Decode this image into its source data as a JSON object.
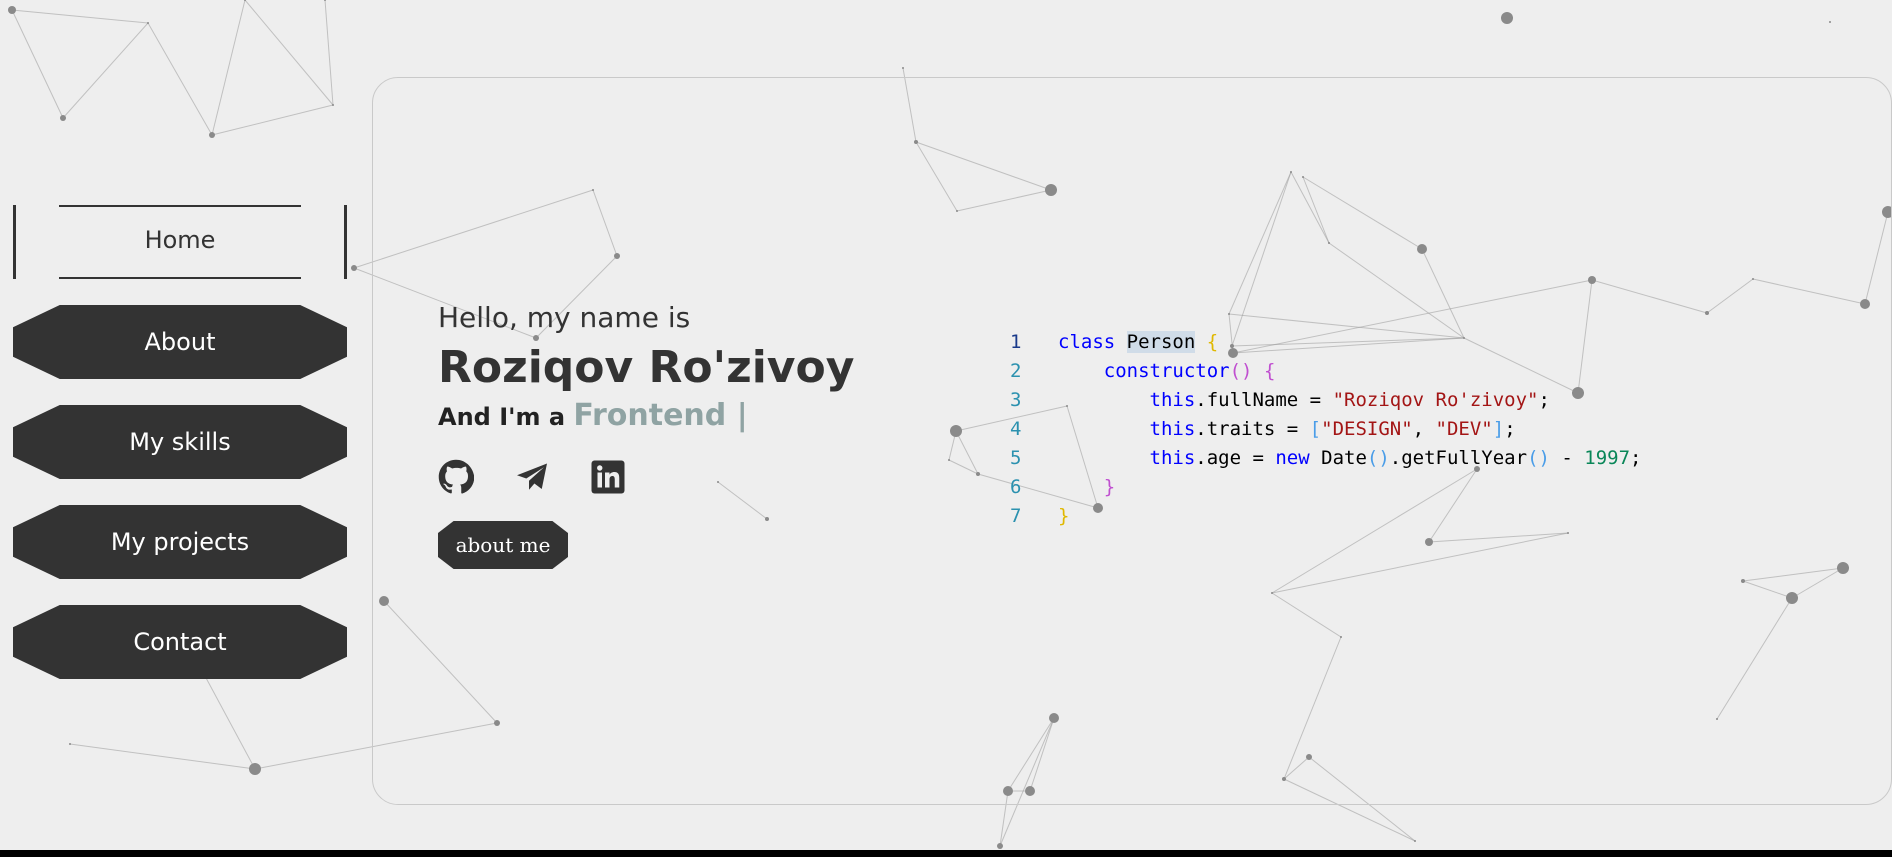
{
  "nav": {
    "items": [
      {
        "label": "Home",
        "active": true
      },
      {
        "label": "About",
        "active": false
      },
      {
        "label": "My skills",
        "active": false
      },
      {
        "label": "My projects",
        "active": false
      },
      {
        "label": "Contact",
        "active": false
      }
    ]
  },
  "hero": {
    "greeting": "Hello, my name is",
    "name": "Roziqov Ro'zivoy",
    "role_prefix": "And I'm a",
    "role": "Frontend |",
    "about_button": "about me",
    "socials": [
      "github-icon",
      "telegram-icon",
      "linkedin-icon"
    ]
  },
  "code": {
    "line_numbers": [
      "1",
      "2",
      "3",
      "4",
      "5",
      "6",
      "7"
    ],
    "kw_class": "class",
    "class_name": "Person",
    "brace_open": "{",
    "constructor": "constructor",
    "parens": "()",
    "this": "this",
    "full_name_prop": ".fullName = ",
    "full_name_value": "\"Roziqov Ro'zivoy\"",
    "traits_prop": ".traits = ",
    "arr_open": "[",
    "trait_1": "\"DESIGN\"",
    "comma": ", ",
    "trait_2": "\"DEV\"",
    "arr_close": "]",
    "age_prop": ".age = ",
    "kw_new": "new",
    "date_call": " Date",
    "get_year": ".getFullYear",
    "minus": " - ",
    "year": "1997",
    "semicolon": ";",
    "brace_close": "}"
  },
  "colors": {
    "button_bg": "#333333",
    "accent_role": "#8fa3a3",
    "background": "#eeeeee"
  }
}
